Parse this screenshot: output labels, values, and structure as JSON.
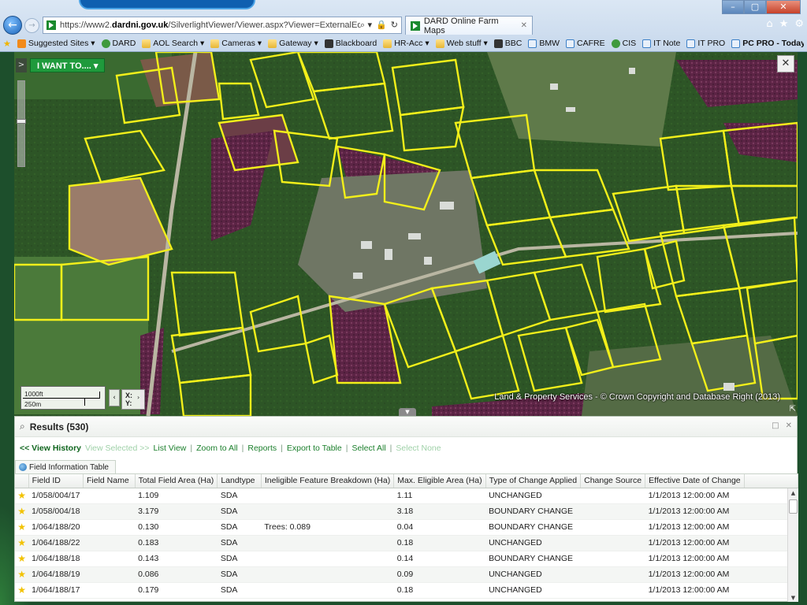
{
  "browser": {
    "window_controls": [
      "–",
      "▢",
      "✕"
    ],
    "url_host_prefix": "https://www2.",
    "url_host_bold": "dardni.gov.uk",
    "url_path": "/SilverlightViewer/Viewer.aspx?Viewer=ExternalEditor",
    "tab_title": "DARD Online Farm Maps",
    "address_icons": [
      "⌕ ▾",
      "🔒",
      "↻"
    ],
    "right_icons": [
      "⌂",
      "★",
      "⚙"
    ]
  },
  "favorites": [
    {
      "label": "Suggested Sites ▾",
      "icon": "orange"
    },
    {
      "label": "DARD",
      "icon": "green"
    },
    {
      "label": "AOL Search ▾",
      "icon": "folder"
    },
    {
      "label": "Cameras ▾",
      "icon": "folder"
    },
    {
      "label": "Gateway ▾",
      "icon": "folder"
    },
    {
      "label": "Blackboard",
      "icon": "dark"
    },
    {
      "label": "HR-Acc ▾",
      "icon": "folder"
    },
    {
      "label": "Web stuff ▾",
      "icon": "folder"
    },
    {
      "label": "BBC",
      "icon": "dark"
    },
    {
      "label": "BMW",
      "icon": "page"
    },
    {
      "label": "CAFRE",
      "icon": "page"
    },
    {
      "label": "CIS",
      "icon": "green"
    },
    {
      "label": "IT Note",
      "icon": "page"
    },
    {
      "label": "IT PRO",
      "icon": "page"
    },
    {
      "label": "PC PRO - Today ▾",
      "icon": "page",
      "bold": true
    }
  ],
  "map": {
    "i_want_to": "I WANT TO.... ▾",
    "panel_toggle": ">",
    "scale_ft": "1000ft",
    "scale_m": "250m",
    "coord_x": "X:",
    "coord_y": "Y:",
    "copyright": "Land & Property Services - © Crown Copyright and Database Right (2013)",
    "tools_icon": "wrench-icon",
    "colors": {
      "field_outline": "#f2ef1a",
      "ineligible": "#6a2550",
      "grass": "#2f5a25"
    }
  },
  "results": {
    "title": "Results (530)",
    "actions": {
      "view_history": "<< View History",
      "view_selected": "View Selected >>",
      "list_view": "List View",
      "zoom_to_all": "Zoom to All",
      "reports": "Reports",
      "export_to_table": "Export to Table",
      "select_all": "Select All",
      "select_none": "Select None"
    },
    "tab_label": "Field Information Table",
    "columns": [
      "Field ID",
      "Field Name",
      "Total Field Area (Ha)",
      "Landtype",
      "Ineligible Feature Breakdown (Ha)",
      "Max. Eligible Area (Ha)",
      "Type of Change Applied",
      "Change Source",
      "Effective Date of Change"
    ],
    "rows": [
      [
        "1/058/004/17",
        "",
        "1.109",
        "SDA",
        "",
        "1.11",
        "UNCHANGED",
        "",
        "1/1/2013 12:00:00 AM"
      ],
      [
        "1/058/004/18",
        "",
        "3.179",
        "SDA",
        "",
        "3.18",
        "BOUNDARY CHANGE",
        "",
        "1/1/2013 12:00:00 AM"
      ],
      [
        "1/064/188/20",
        "",
        "0.130",
        "SDA",
        "Trees: 0.089",
        "0.04",
        "BOUNDARY CHANGE",
        "",
        "1/1/2013 12:00:00 AM"
      ],
      [
        "1/064/188/22",
        "",
        "0.183",
        "SDA",
        "",
        "0.18",
        "UNCHANGED",
        "",
        "1/1/2013 12:00:00 AM"
      ],
      [
        "1/064/188/18",
        "",
        "0.143",
        "SDA",
        "",
        "0.14",
        "BOUNDARY CHANGE",
        "",
        "1/1/2013 12:00:00 AM"
      ],
      [
        "1/064/188/19",
        "",
        "0.086",
        "SDA",
        "",
        "0.09",
        "UNCHANGED",
        "",
        "1/1/2013 12:00:00 AM"
      ],
      [
        "1/064/188/17",
        "",
        "0.179",
        "SDA",
        "",
        "0.18",
        "UNCHANGED",
        "",
        "1/1/2013 12:00:00 AM"
      ]
    ]
  }
}
